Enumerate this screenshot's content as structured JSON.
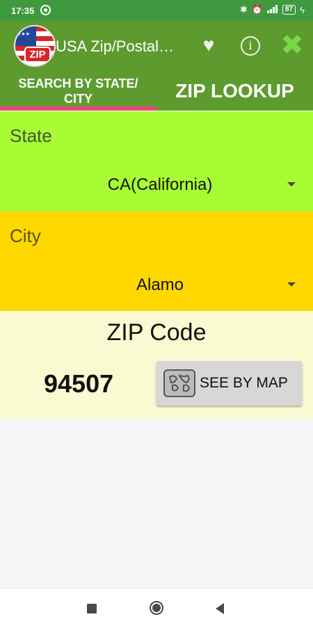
{
  "status_bar": {
    "time": "17:35",
    "battery": "87"
  },
  "app_bar": {
    "title": "USA Zip/Postal Code",
    "logo_text": "ZIP"
  },
  "tabs": [
    {
      "label": "SEARCH BY STATE/ CITY",
      "selected": true
    },
    {
      "label": "ZIP LOOKUP",
      "selected": false
    }
  ],
  "state": {
    "label": "State",
    "selected": "CA(California)"
  },
  "city": {
    "label": "City",
    "selected": "Alamo"
  },
  "zip": {
    "label": "ZIP Code",
    "value": "94507",
    "map_button": "SEE BY MAP"
  },
  "colors": {
    "status_bar": "#3f9a3f",
    "app_bar": "#5e9b2f",
    "tab_indicator": "#e6457a",
    "state_bg": "#a7fc33",
    "city_bg": "#ffd800",
    "zip_bg": "#fafad2"
  },
  "icons": {
    "status_app": "app-notification-icon",
    "status_right": [
      "bluetooth-icon",
      "alarm-icon",
      "signal-icon",
      "battery-icon",
      "charging-icon"
    ],
    "favorite": "heart-icon",
    "info": "info-icon",
    "close": "close-icon",
    "map": "map-icon",
    "nav": [
      "recent-apps-icon",
      "home-icon",
      "back-icon"
    ]
  }
}
